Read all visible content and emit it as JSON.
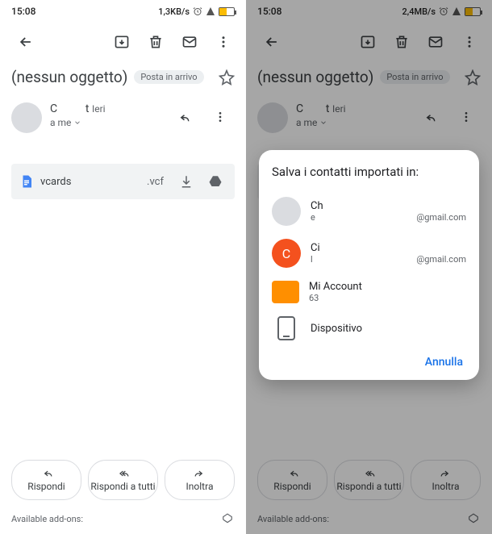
{
  "statusbar": {
    "time": "15:08",
    "net_left": "1,3KB/s",
    "net_right": "2,4MB/s",
    "battery": "46"
  },
  "email": {
    "subject": "(nessun oggetto)",
    "folder": "Posta in arrivo",
    "sender_initial": "C",
    "sender_suffix": "t",
    "time": "Ieri",
    "to": "a me"
  },
  "attachment": {
    "name": "vcards",
    "ext": ".vcf"
  },
  "actions": {
    "reply": "Rispondi",
    "reply_all": "Rispondi a tutti",
    "forward": "Inoltra"
  },
  "addons_label": "Available add-ons:",
  "dialog": {
    "title": "Salva i contatti importati in:",
    "cancel": "Annulla",
    "accounts": [
      {
        "name": "Ch",
        "sub1": "e",
        "sub2": "@gmail.com"
      },
      {
        "name": "Ci",
        "sub1": "l",
        "sub2": "@gmail.com"
      },
      {
        "name": "Mi Account",
        "sub1": "63",
        "sub2": ""
      },
      {
        "name": "Dispositivo",
        "sub1": "",
        "sub2": ""
      }
    ]
  }
}
